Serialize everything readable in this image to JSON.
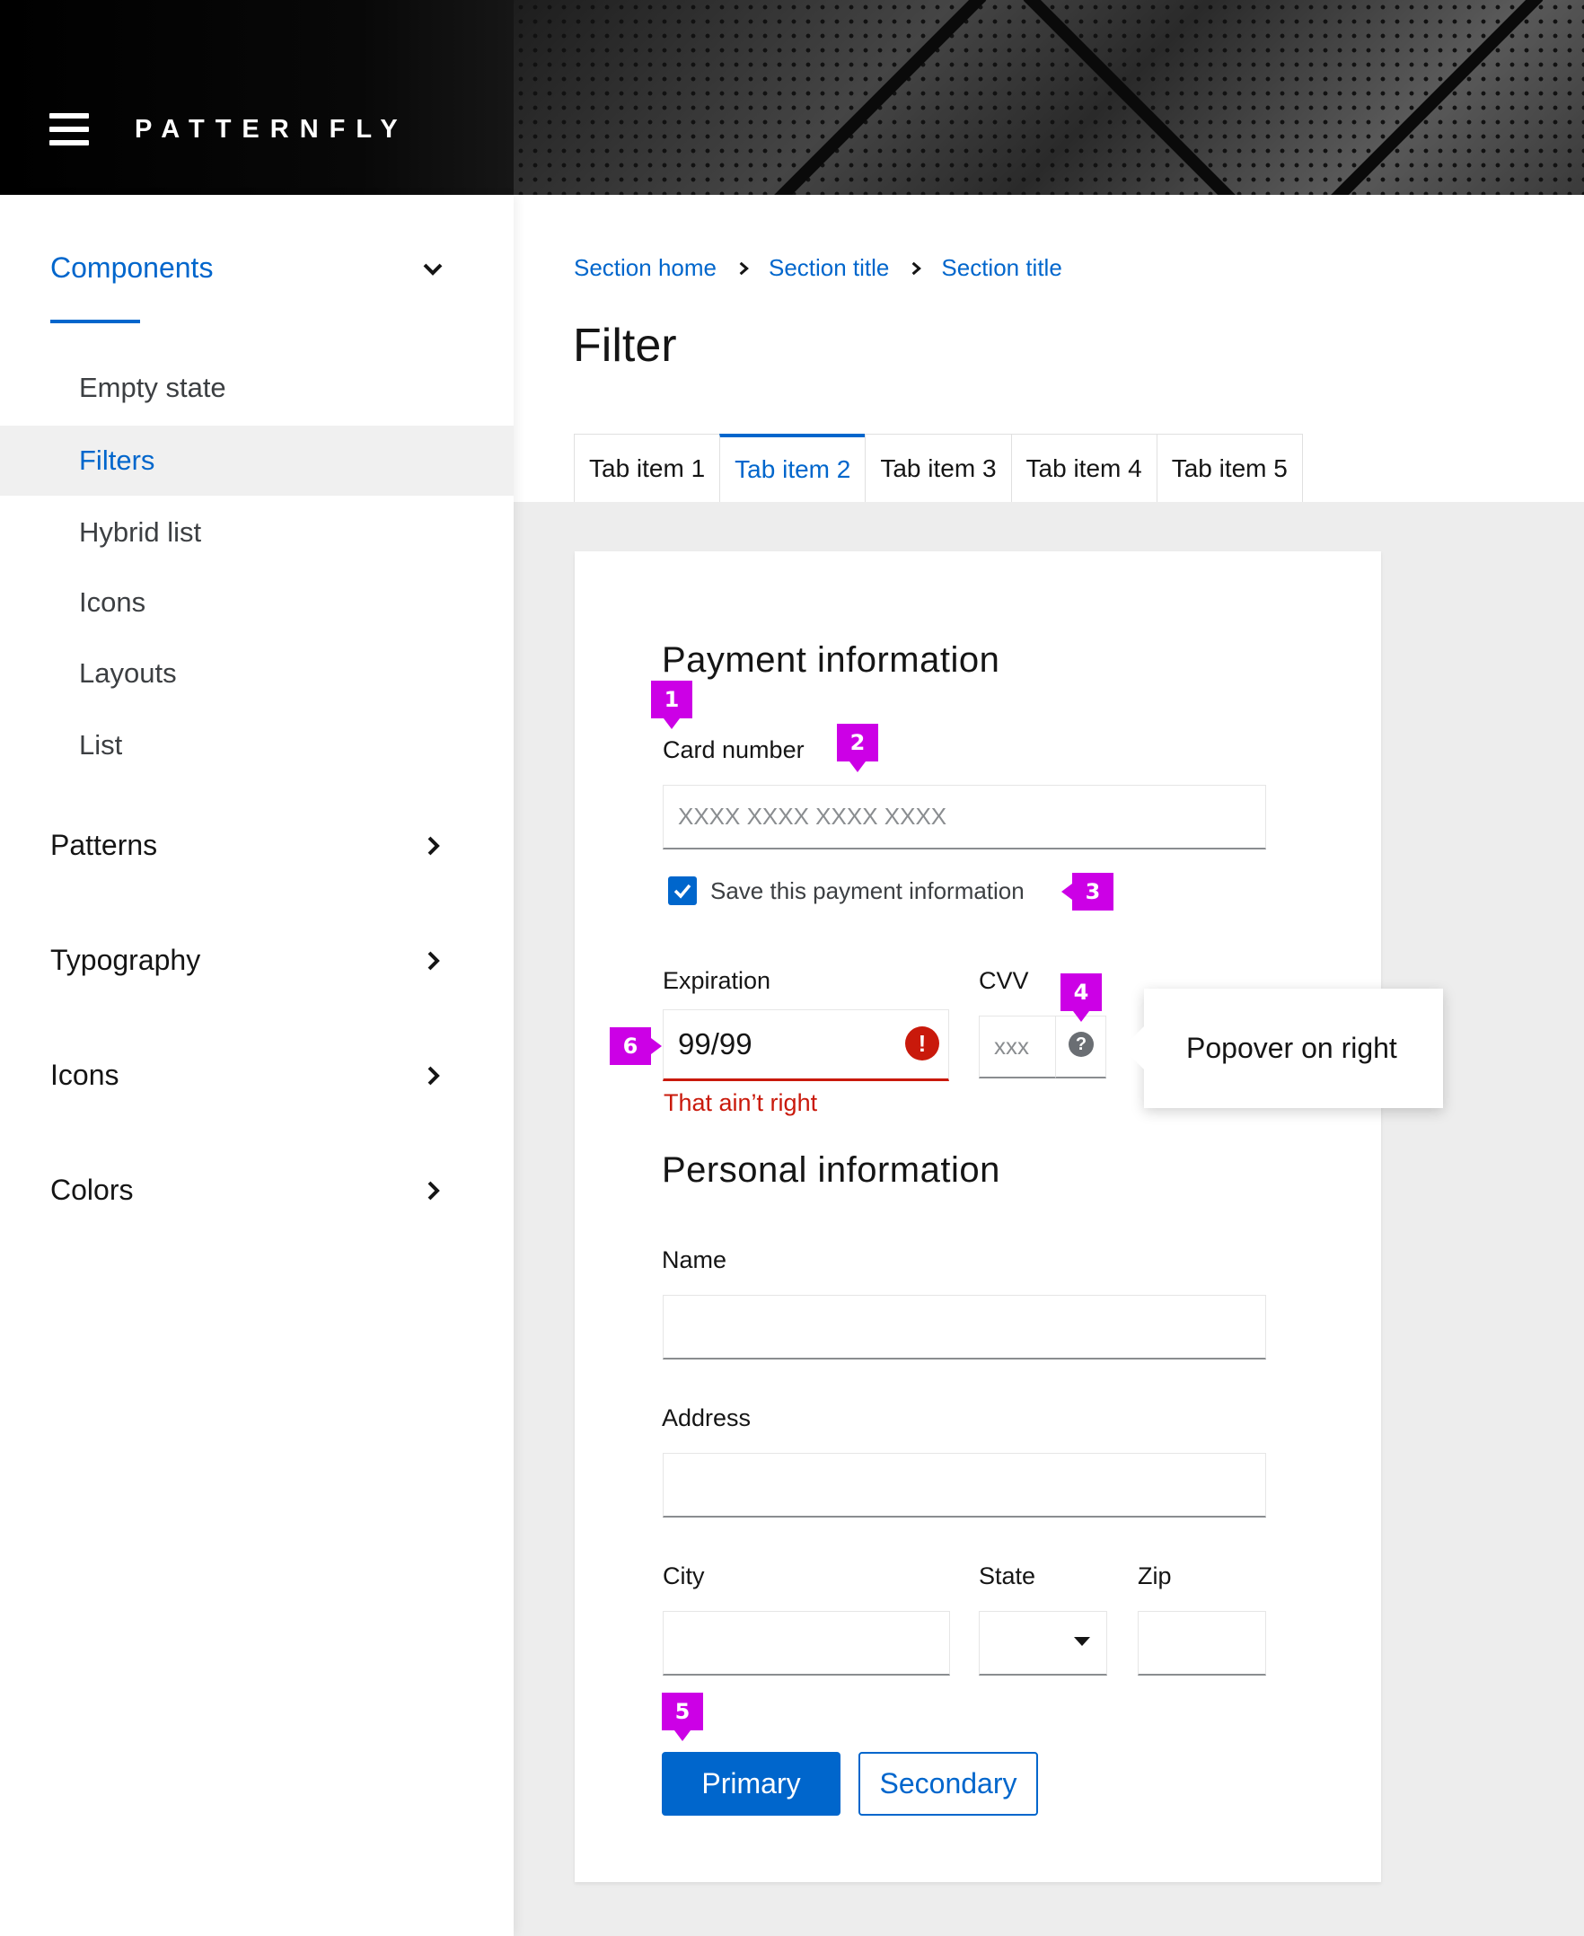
{
  "header": {
    "brand": "PATTERNFLY"
  },
  "sidebar": {
    "groups": [
      {
        "label": "Components",
        "expanded": true
      },
      {
        "label": "Patterns",
        "expanded": false
      },
      {
        "label": "Typography",
        "expanded": false
      },
      {
        "label": "Icons",
        "expanded": false
      },
      {
        "label": "Colors",
        "expanded": false
      }
    ],
    "items": [
      {
        "label": "Empty state"
      },
      {
        "label": "Filters",
        "selected": true
      },
      {
        "label": "Hybrid list"
      },
      {
        "label": "Icons"
      },
      {
        "label": "Layouts"
      },
      {
        "label": "List"
      }
    ]
  },
  "breadcrumb": [
    "Section home",
    "Section title",
    "Section title"
  ],
  "page": {
    "title": "Filter"
  },
  "tabs": [
    {
      "label": "Tab item 1"
    },
    {
      "label": "Tab item 2",
      "active": true
    },
    {
      "label": "Tab item 3"
    },
    {
      "label": "Tab item 4"
    },
    {
      "label": "Tab item 5"
    }
  ],
  "form": {
    "payment_title": "Payment information",
    "card_number_label": "Card number",
    "card_number_placeholder": "XXXX XXXX XXXX XXXX",
    "save_payment_label": "Save this payment information",
    "save_payment_checked": true,
    "expiration_label": "Expiration",
    "expiration_value": "99/99",
    "expiration_error": "That ain’t right",
    "cvv_label": "CVV",
    "cvv_placeholder": "xxx",
    "popover_text": "Popover on right",
    "personal_title": "Personal information",
    "name_label": "Name",
    "address_label": "Address",
    "city_label": "City",
    "state_label": "State",
    "zip_label": "Zip",
    "primary_label": "Primary",
    "secondary_label": "Secondary"
  },
  "markers": [
    "1",
    "2",
    "3",
    "4",
    "5",
    "6"
  ],
  "colors": {
    "accent": "#0066cc",
    "error": "#c9190b",
    "marker": "#cc00e6"
  },
  "icons": {
    "menu": "hamburger-icon",
    "expand": "chevron-down-icon",
    "collapsed": "chevron-right-icon",
    "error": "exclamation-circle-icon",
    "help": "question-circle-icon",
    "check": "checkmark-icon",
    "select": "caret-down-icon"
  }
}
